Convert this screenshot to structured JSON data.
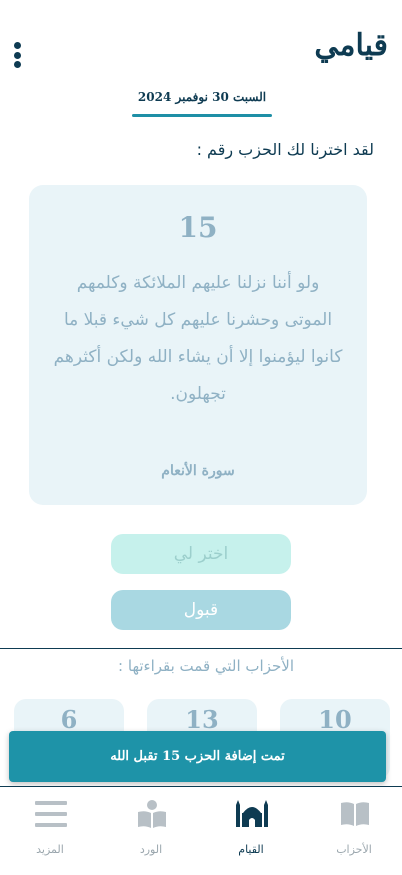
{
  "header": {
    "app_title": "قيامي",
    "date": "السبت 30 نوفمبر 2024"
  },
  "prompt": "لقد اخترنا لك الحزب رقم :",
  "verse_card": {
    "hizb_number": "15",
    "verse_text": "ولو أننا نزلنا عليهم الملائكة وكلمهم الموتى وحشرنا عليهم كل شيء قبلا ما كانوا ليؤمنوا إلا أن يشاء الله ولكن أكثرهم تجهلون.",
    "surah": "سورة الأنعام"
  },
  "buttons": {
    "choose_label": "اختر لي",
    "accept_label": "قبول"
  },
  "history": {
    "title": "الأحزاب التي قمت بقراءتها :",
    "items": [
      "10",
      "13",
      "6"
    ]
  },
  "toast": {
    "message": "تمت إضافة الحزب 15 تقبل الله"
  },
  "nav": {
    "items": [
      {
        "label": "الأحزاب",
        "icon": "open-book-icon",
        "active": false
      },
      {
        "label": "القيام",
        "icon": "mosque-icon",
        "active": true
      },
      {
        "label": "الورد",
        "icon": "reader-icon",
        "active": false
      },
      {
        "label": "المزيد",
        "icon": "menu-icon",
        "active": false
      }
    ]
  },
  "colors": {
    "primary": "#0e3b52",
    "accent": "#1e93a8",
    "card_bg": "#e9f4f8",
    "muted_text": "#8fb1c4"
  }
}
